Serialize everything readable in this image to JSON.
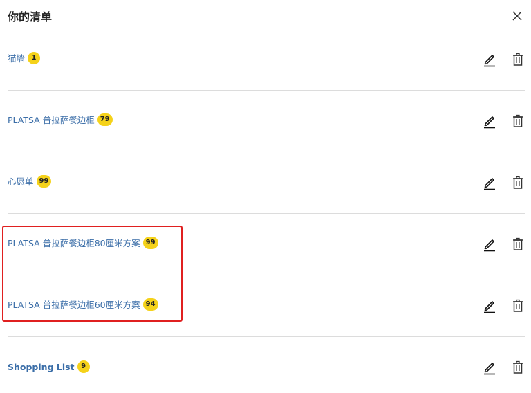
{
  "header": {
    "title": "你的清单"
  },
  "lists": [
    {
      "name": "猫墙",
      "count": "1"
    },
    {
      "name": "PLATSA 普拉萨餐边柜",
      "count": "79"
    },
    {
      "name": "心愿单",
      "count": "99"
    },
    {
      "name": "PLATSA 普拉萨餐边柜80厘米方案",
      "count": "99"
    },
    {
      "name": "PLATSA 普拉萨餐边柜60厘米方案",
      "count": "94"
    },
    {
      "name": "Shopping List",
      "count": "9"
    }
  ],
  "icons": {
    "close": "close-icon",
    "edit": "pencil-icon",
    "delete": "trash-icon"
  },
  "colors": {
    "link": "#3b6ea8",
    "badge": "#f5d21a",
    "highlight": "#e02020",
    "divider": "#dcdcdc"
  }
}
